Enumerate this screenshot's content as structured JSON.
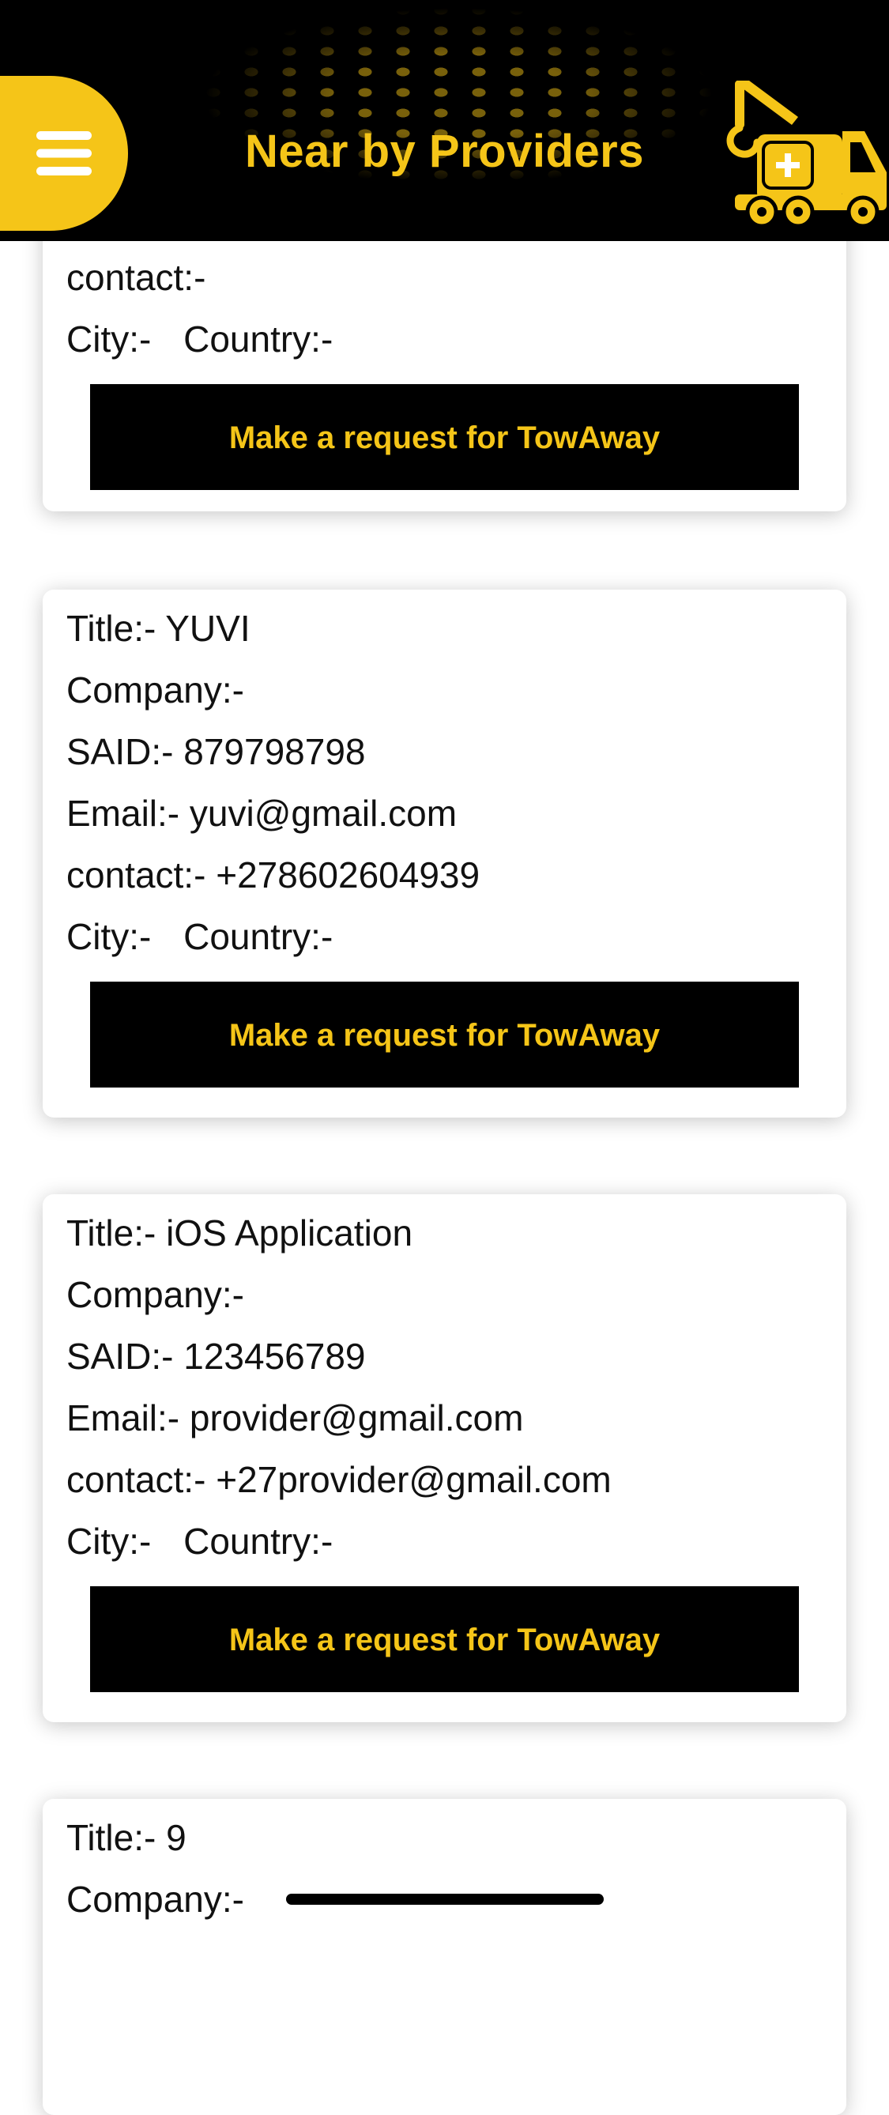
{
  "header": {
    "title": "Near by Providers",
    "menu_icon": "hamburger-menu-icon",
    "logo_icon": "tow-truck-icon",
    "accent_color": "#F5C518",
    "background_color": "#000000"
  },
  "labels": {
    "title": "Title:-",
    "company": "Company:-",
    "said": "SAID:-",
    "email": "Email:-",
    "contact": "contact:-",
    "city": "City:-",
    "country": "Country:-"
  },
  "providers": [
    {
      "title": "",
      "company": "",
      "said": "",
      "email": "",
      "contact": "",
      "city": "",
      "country": "",
      "button_label": "Make a request for TowAway"
    },
    {
      "title": "YUVI",
      "company": "",
      "said": "879798798",
      "email": "yuvi@gmail.com",
      "contact": "+278602604939",
      "city": "",
      "country": "",
      "button_label": "Make a request for TowAway"
    },
    {
      "title": "iOS Application",
      "company": "",
      "said": "123456789",
      "email": "provider@gmail.com",
      "contact": "+27provider@gmail.com",
      "city": "",
      "country": "",
      "button_label": "Make a request for TowAway"
    },
    {
      "title": "9",
      "company": "",
      "button_label": ""
    }
  ]
}
